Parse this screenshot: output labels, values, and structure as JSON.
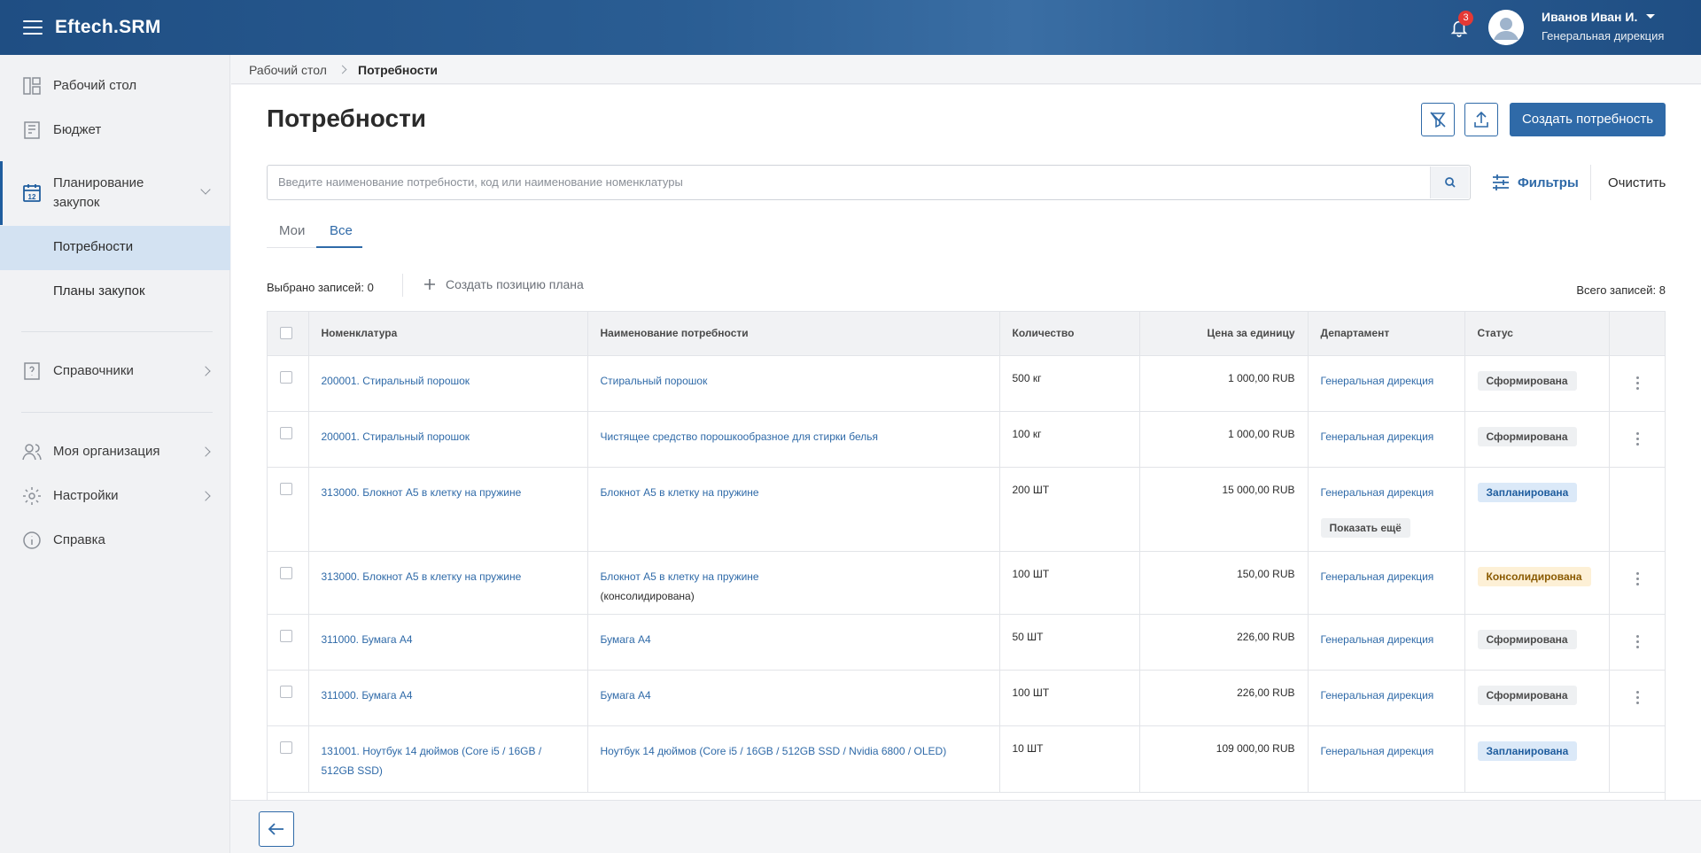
{
  "app": {
    "brand": "Eftech.SRM",
    "notifications_count": "3"
  },
  "user": {
    "name": "Иванов Иван И.",
    "department": "Генеральная дирекция"
  },
  "sidebar": {
    "items": [
      {
        "label": "Рабочий стол",
        "icon": "dashboard-icon"
      },
      {
        "label": "Бюджет",
        "icon": "budget-icon"
      },
      {
        "label": "Планирование закупок",
        "icon": "calendar-icon"
      },
      {
        "label": "Справочники",
        "icon": "reference-icon"
      },
      {
        "label": "Моя организация",
        "icon": "users-icon"
      },
      {
        "label": "Настройки",
        "icon": "gear-icon"
      },
      {
        "label": "Справка",
        "icon": "info-icon"
      }
    ],
    "subitems": [
      {
        "label": "Потребности",
        "selected": true
      },
      {
        "label": "Планы закупок",
        "selected": false
      }
    ]
  },
  "breadcrumb": {
    "root": "Рабочий стол",
    "current": "Потребности"
  },
  "page": {
    "title": "Потребности",
    "create_label": "Создать потребность",
    "search_placeholder": "Введите наименование потребности, код или наименование номенклатуры",
    "filters_label": "Фильтры",
    "clear_label": "Очистить",
    "tabs": [
      {
        "label": "Мои"
      },
      {
        "label": "Все",
        "active": true
      }
    ],
    "selected_text": "Выбрано записей: 0",
    "create_plan_label": "Создать позицию плана",
    "total_text": "Всего записей: 8"
  },
  "table": {
    "columns": [
      "Номенклатура",
      "Наименование потребности",
      "Количество",
      "Цена за единицу",
      "Департамент",
      "Статус"
    ],
    "rows": [
      {
        "nom": "200001. Стиральный порошок",
        "name": "Стиральный порошок",
        "name2": "",
        "qty": "500 кг",
        "price": "1 000,00 RUB",
        "dept": "Генеральная дирекция",
        "status": "Сформирована",
        "status_type": "formed",
        "show_more": "",
        "menu": true
      },
      {
        "nom": "200001. Стиральный порошок",
        "name": "Чистящее средство порошкообразное для стирки белья",
        "name2": "",
        "qty": "100 кг",
        "price": "1 000,00 RUB",
        "dept": "Генеральная дирекция",
        "status": "Сформирована",
        "status_type": "formed",
        "show_more": "",
        "menu": true
      },
      {
        "nom": "313000. Блокнот А5 в клетку на пружине",
        "name": "Блокнот А5 в клетку на пружине",
        "name2": "",
        "qty": "200 ШТ",
        "price": "15 000,00 RUB",
        "dept": "Генеральная дирекция",
        "status": "Запланирована",
        "status_type": "planned",
        "show_more": "Показать ещё",
        "menu": false
      },
      {
        "nom": "313000. Блокнот А5 в клетку на пружине",
        "name": "Блокнот А5 в клетку на пружине",
        "name2": "(консолидирована)",
        "qty": "100 ШТ",
        "price": "150,00 RUB",
        "dept": "Генеральная дирекция",
        "status": "Консолидирована",
        "status_type": "consolidated",
        "show_more": "",
        "menu": true
      },
      {
        "nom": "311000. Бумага А4",
        "name": "Бумага А4",
        "name2": "",
        "qty": "50 ШТ",
        "price": "226,00 RUB",
        "dept": "Генеральная дирекция",
        "status": "Сформирована",
        "status_type": "formed",
        "show_more": "",
        "menu": true
      },
      {
        "nom": "311000. Бумага А4",
        "name": "Бумага А4",
        "name2": "",
        "qty": "100 ШТ",
        "price": "226,00 RUB",
        "dept": "Генеральная дирекция",
        "status": "Сформирована",
        "status_type": "formed",
        "show_more": "",
        "menu": true
      },
      {
        "nom": "131001. Ноутбук 14 дюймов (Core i5 / 16GB / 512GB SSD)",
        "name": "Ноутбук 14 дюймов (Core i5 / 16GB / 512GB SSD / Nvidia 6800 / OLED)",
        "name2": "",
        "qty": "10 ШТ",
        "price": "109 000,00 RUB",
        "dept": "Генеральная дирекция",
        "status": "Запланирована",
        "status_type": "planned",
        "show_more": "",
        "menu": false
      }
    ]
  },
  "colors": {
    "primary": "#2f6aa8",
    "header": "#1f4e83",
    "selected_nav": "#d3e2f2"
  }
}
